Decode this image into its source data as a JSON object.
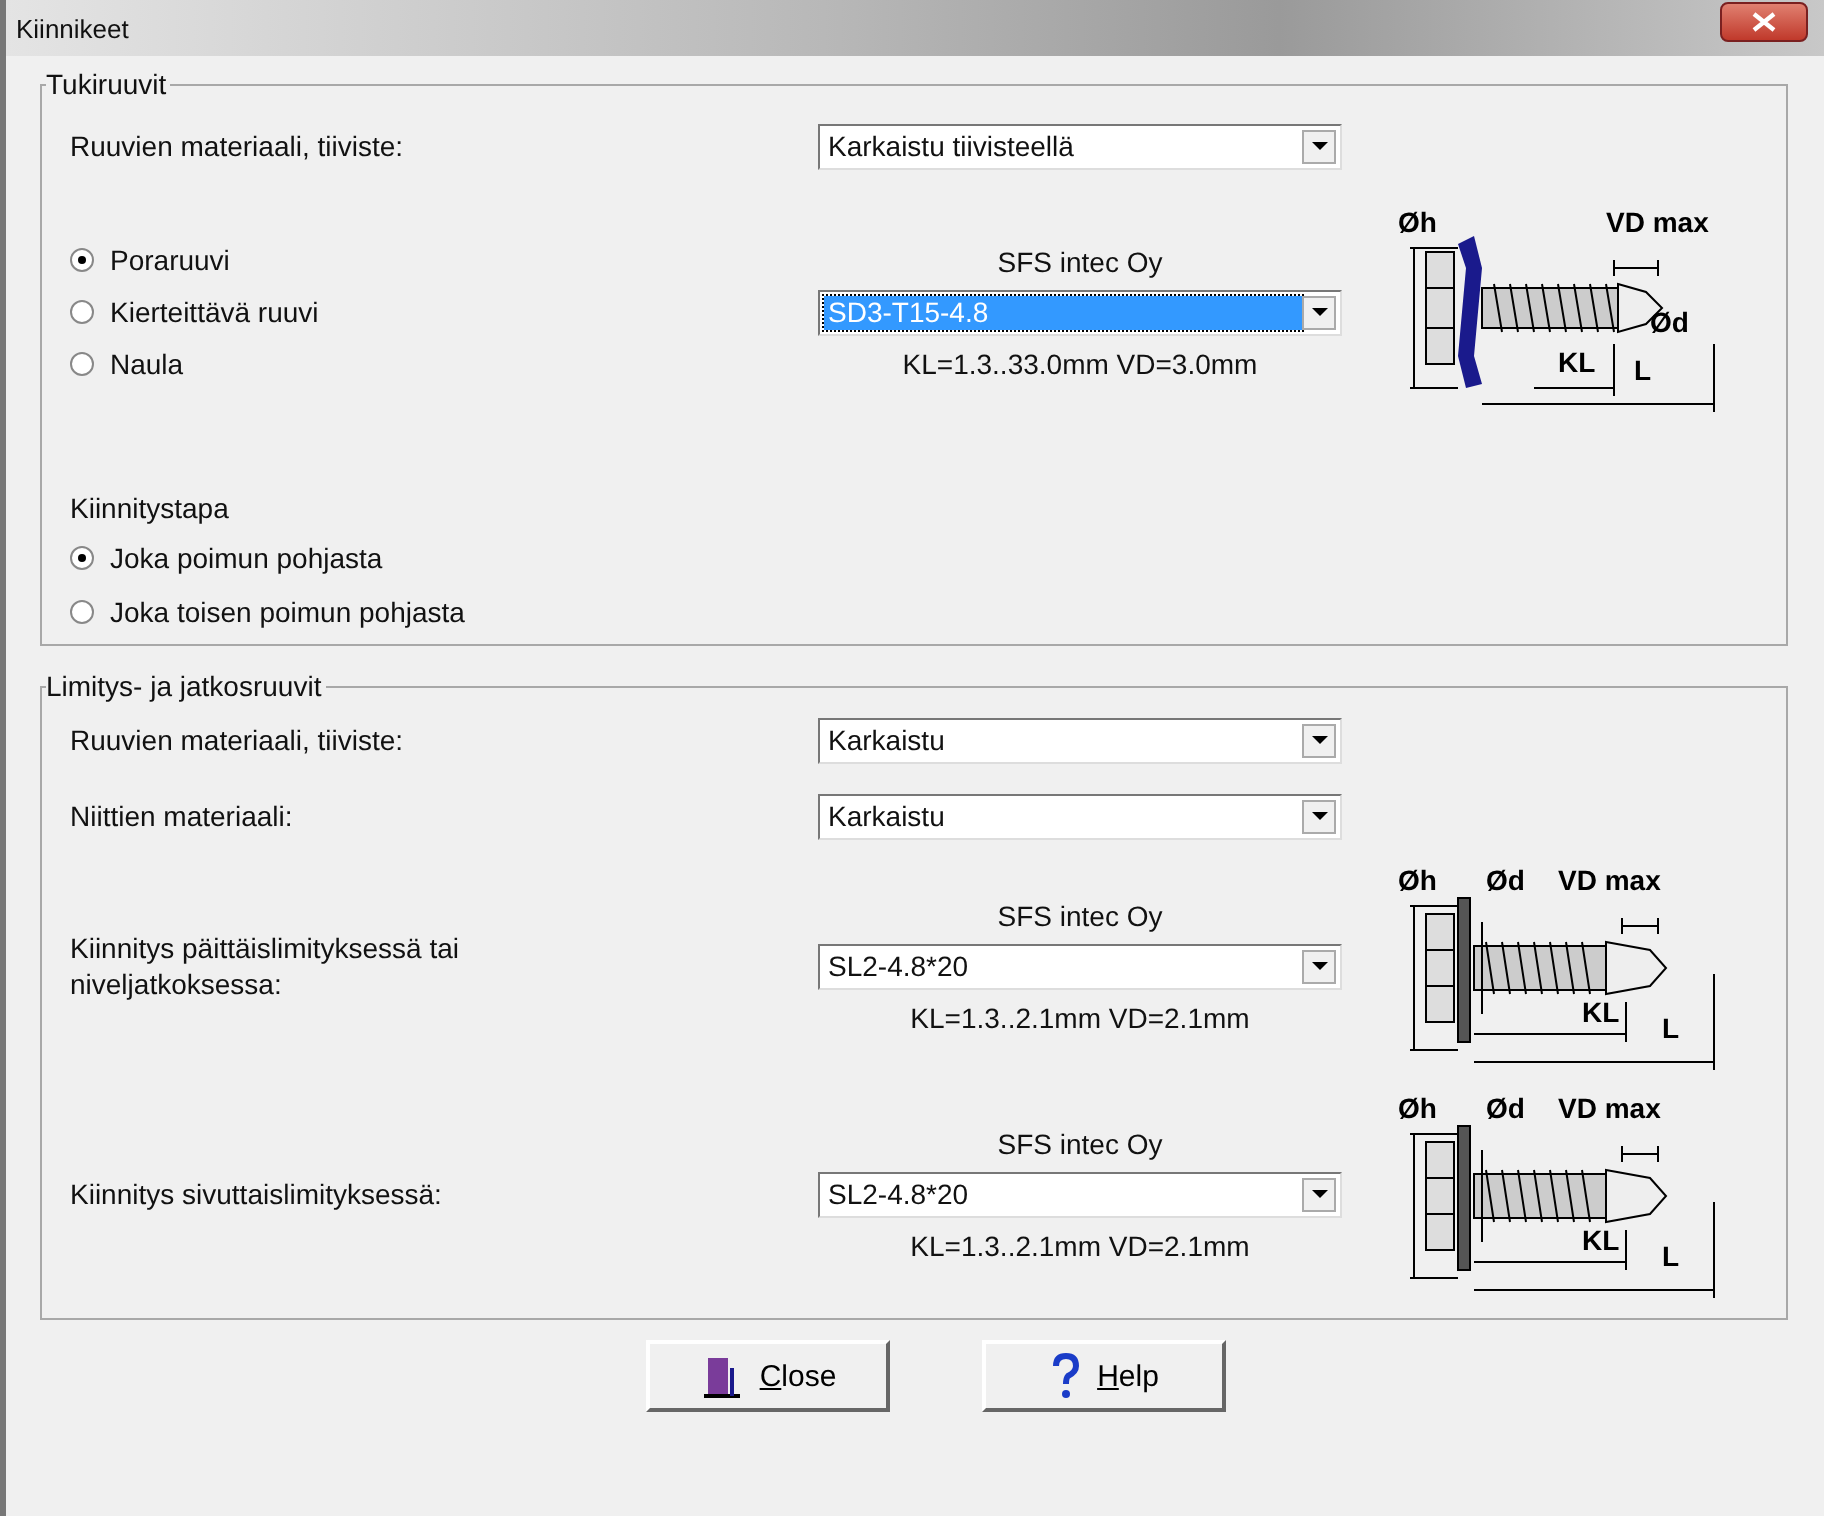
{
  "window": {
    "title": "Kiinnikeet"
  },
  "groups": [
    {
      "title": "Tukiruuvit",
      "rows": [
        {
          "kind": "select",
          "label": "Ruuvien materiaali, tiiviste:",
          "value": "Karkaistu tiivisteellä",
          "highlighted": false
        },
        {
          "kind": "product",
          "options": [
            {
              "label": "Poraruuvi",
              "selected": true
            },
            {
              "label": "Kierteittävä ruuvi",
              "selected": false
            },
            {
              "label": "Naula",
              "selected": false
            }
          ],
          "maker": "SFS intec Oy",
          "value": "SD3-T15-4.8",
          "highlighted": true,
          "info": "KL=1.3..33.0mm  VD=3.0mm",
          "diagram": {
            "kind": "sealed",
            "labels": [
              "Øh",
              "VD max",
              "Ød",
              "KL",
              "L"
            ]
          }
        },
        {
          "kind": "radios",
          "label": "Kiinnitystapa",
          "options": [
            {
              "label": "Joka poimun pohjasta",
              "selected": true
            },
            {
              "label": "Joka toisen poimun pohjasta",
              "selected": false
            }
          ]
        }
      ]
    },
    {
      "title": "Limitys- ja jatkosruuvit",
      "rows": [
        {
          "kind": "select",
          "label": "Ruuvien materiaali, tiiviste:",
          "value": "Karkaistu",
          "highlighted": false
        },
        {
          "kind": "select",
          "label": "Niittien materiaali:",
          "value": "Karkaistu",
          "highlighted": false
        },
        {
          "kind": "product",
          "label": "Kiinnitys päittäislimityksessä tai niveljatkoksessa:",
          "maker": "SFS intec Oy",
          "value": "SL2-4.8*20",
          "highlighted": false,
          "info": "KL=1.3..2.1mm  VD=2.1mm",
          "diagram": {
            "kind": "washer",
            "labels": [
              "Øh",
              "Ød",
              "VD max",
              "KL",
              "L"
            ]
          }
        },
        {
          "kind": "product",
          "label": "Kiinnitys sivuttaislimityksessä:",
          "maker": "SFS intec Oy",
          "value": "SL2-4.8*20",
          "highlighted": false,
          "info": "KL=1.3..2.1mm  VD=2.1mm",
          "diagram": {
            "kind": "washer",
            "labels": [
              "Øh",
              "Ød",
              "VD max",
              "KL",
              "L"
            ]
          }
        }
      ]
    }
  ],
  "buttons": [
    {
      "kind": "close",
      "label": "Close"
    },
    {
      "kind": "help",
      "label": "Help"
    }
  ]
}
